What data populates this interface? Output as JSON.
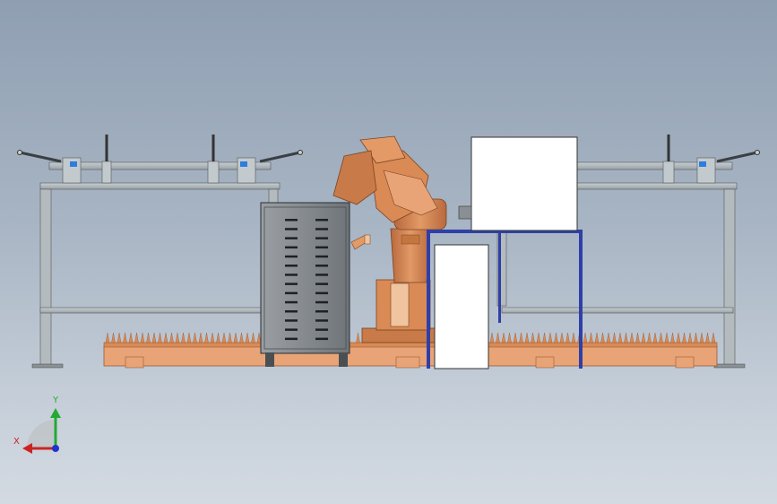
{
  "viewport": {
    "background_top": "#8f9fb2",
    "background_bottom": "#d3dae2"
  },
  "colors": {
    "robot_orange": "#d98a55",
    "robot_shadow": "#a8623a",
    "frame_steel": "#a9b2b6",
    "frame_dark": "#4a5156",
    "cabinet_gray": "#8a8f93",
    "table_blue": "#2f3fa8",
    "panel_white": "#ffffff"
  },
  "triad": {
    "x_label": "X",
    "y_label": "Y",
    "x_color": "#cc2222",
    "y_color": "#22aa33",
    "z_color": "#2233cc",
    "x_icon": "arrow-left-icon",
    "y_icon": "arrow-up-icon",
    "origin_icon": "axis-origin-icon"
  },
  "scene": {
    "objects": [
      "robot-arm",
      "control-cabinet",
      "welding-fixture-left",
      "welding-fixture-right",
      "equipment-table",
      "linear-track-base"
    ]
  }
}
